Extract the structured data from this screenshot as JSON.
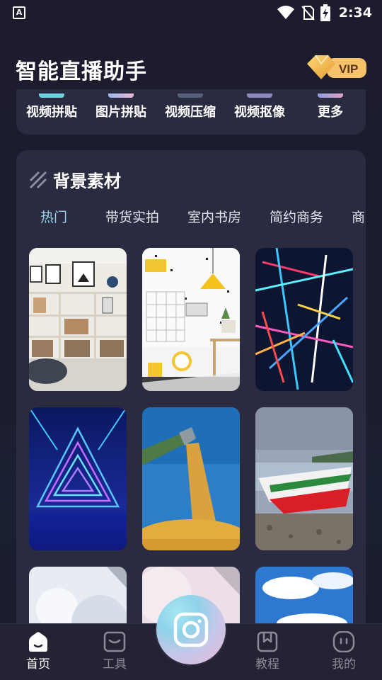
{
  "status_bar": {
    "app_icon_letter": "A",
    "time": "2:34",
    "icons": [
      "wifi-icon",
      "no-sim-icon",
      "battery-charging-icon"
    ]
  },
  "header": {
    "title": "智能直播助手",
    "vip_label": "VIP"
  },
  "tools": [
    {
      "label": "视频拼贴",
      "accent": "#6fd0e0"
    },
    {
      "label": "图片拼贴",
      "accent": "#9bb8f2"
    },
    {
      "label": "视频压缩",
      "accent": "#7a8aa8"
    },
    {
      "label": "视频抠像",
      "accent": "#a5a5d8"
    },
    {
      "label": "更多",
      "accent": "#d7a6c9"
    }
  ],
  "background_section": {
    "title": "背景素材",
    "tabs": [
      {
        "label": "热门",
        "active": true
      },
      {
        "label": "带货实拍",
        "active": false
      },
      {
        "label": "室内书房",
        "active": false
      },
      {
        "label": "简约商务",
        "active": false
      },
      {
        "label": "商",
        "active": false
      }
    ],
    "thumbnails": [
      "shelf-room-image",
      "yellow-lamp-room-image",
      "neon-lines-image",
      "neon-triangle-image",
      "grain-harvest-image",
      "boat-shore-image",
      "snow-tree-image",
      "pink-snow-image",
      "blue-sky-clouds-image"
    ]
  },
  "bottom_nav": {
    "items": [
      {
        "label": "首页",
        "icon": "home-icon",
        "active": true
      },
      {
        "label": "工具",
        "icon": "toolbox-icon",
        "active": false
      },
      {
        "label": "教程",
        "icon": "bookmark-book-icon",
        "active": false
      },
      {
        "label": "我的",
        "icon": "profile-face-icon",
        "active": false
      }
    ],
    "center_icon": "camera-icon"
  },
  "colors": {
    "accent_tab": "#9ad3ea",
    "card_bg": "#2a2a40",
    "vip_gold": "#f0b24a"
  }
}
